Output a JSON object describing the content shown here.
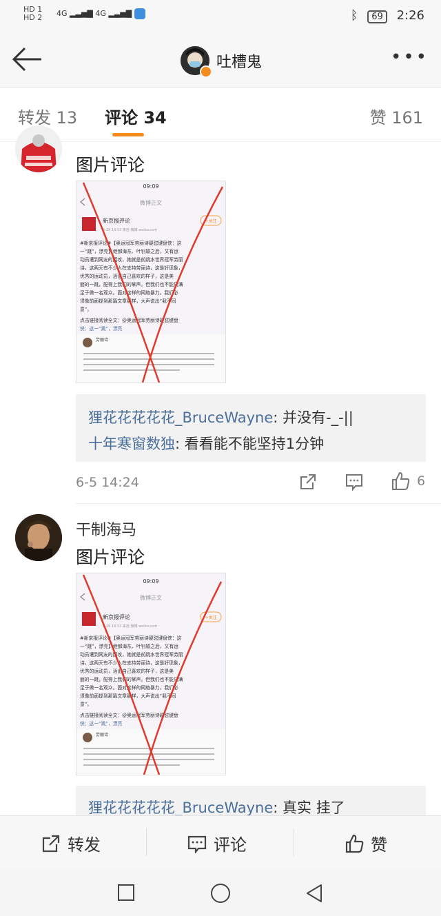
{
  "status_bar": {
    "hd1": "HD 1",
    "hd2": "HD 2",
    "net1": "4G",
    "net2": "4G",
    "battery": "69",
    "time": "2:26"
  },
  "header": {
    "title": "吐槽鬼"
  },
  "tabs": [
    {
      "label": "转发 13"
    },
    {
      "label": "评论 34"
    },
    {
      "label": "赞 161"
    }
  ],
  "comments": [
    {
      "text": "图片评论",
      "replies": [
        {
          "name": "狸花花花花花_BruceWayne",
          "text": ": 并没有-_-||"
        },
        {
          "name": "十年寒窗数独",
          "text": ": 看看能不能坚持1分钟"
        }
      ],
      "time": "6-5 14:24",
      "likes": "6"
    },
    {
      "username": "干制海马",
      "text": "图片评论",
      "replies": [
        {
          "name": "狸花花花花花_BruceWayne",
          "text": ": 真实 挂了"
        }
      ]
    }
  ],
  "thumbnail": {
    "time": "09:09",
    "nav_title": "微博正文",
    "account": "新京报评论",
    "meta": "5-29 16:53  来自 微博 weibo.com",
    "follow": "+关注",
    "line1": "#新京报评论#【奥运冠军劳丽诗硬怼键盘侠：这",
    "line2": "一“跳”，漂亮】继郝海东、叶钊颖之后，又有运",
    "line3": "动员遭到网友的围攻，她就是前跳水世界冠军劳丽",
    "line4": "诗。这两天有不少人在支持劳丽诗，这是好现象，",
    "line5": "优秀的运动员，活出自己喜欢的样子，这是美",
    "line6": "丽的一跳，配得上我们的掌声。但我们也不能只满",
    "line7": "足于做一名观众。面对这样的网络暴力，我们必",
    "line8": "须像前面提到那篇文章那样，大声说出“我不同",
    "line9": "意”。",
    "link1": "点击链接阅读全文：@奥运冠军劳丽诗硬怼键盘",
    "link2": "侠：这一“跳”，漂亮",
    "quote_user": "劳丽诗"
  },
  "bottom_bar": {
    "repost": "转发",
    "comment": "评论",
    "like": "赞"
  },
  "colors": {
    "accent": "#f38b1d",
    "link": "#4a6f9b",
    "cross": "#e03a2e"
  }
}
